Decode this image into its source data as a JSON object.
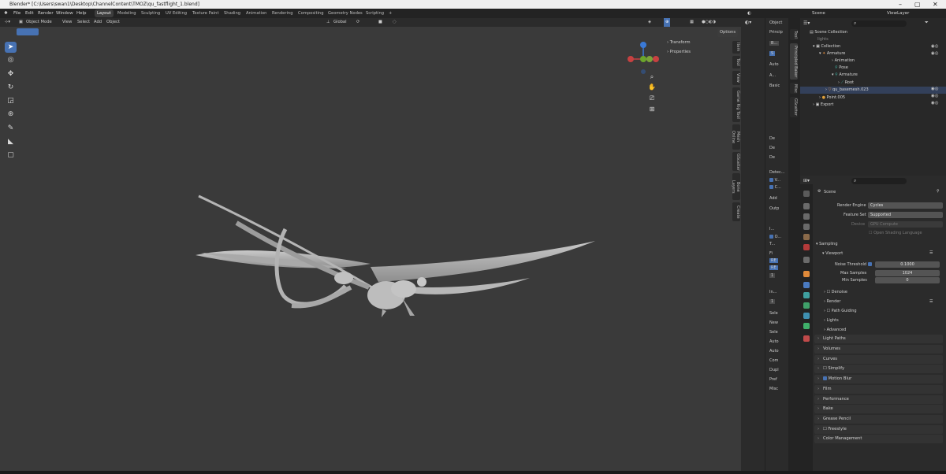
{
  "window": {
    "title": "Blender* [C:\\Users\\swan1\\Desktop\\ChannelContent\\TMOZ\\qu_fastflight_1.blend]"
  },
  "menu": [
    "File",
    "Edit",
    "Render",
    "Window",
    "Help"
  ],
  "workspaces": [
    "Layout",
    "Modeling",
    "Sculpting",
    "UV Editing",
    "Texture Paint",
    "Shading",
    "Animation",
    "Rendering",
    "Compositing",
    "Geometry Nodes",
    "Scripting",
    "+"
  ],
  "viewport": {
    "header": {
      "mode": "Object Mode",
      "menus": [
        "View",
        "Select",
        "Add",
        "Object"
      ],
      "orientation": "Global",
      "options": "Options"
    },
    "npanel": [
      "Transform",
      "Properties"
    ],
    "side_tabs": [
      "Item",
      "Tool",
      "View",
      "Game Rig Tool",
      "Mesh Online",
      "GScatter",
      "Bone Layers",
      "Create"
    ],
    "tools": [
      "select-box",
      "cursor",
      "move",
      "rotate",
      "scale",
      "transform",
      "annotate",
      "measure",
      "add-cube"
    ]
  },
  "mid_tabs": [
    "Tool",
    "Principled Baker",
    "Misc",
    "GScatter"
  ],
  "addon": {
    "mode": "Object",
    "labels": [
      "Princip",
      "B...",
      "S",
      "Auto",
      "A...",
      "Basic",
      "De",
      "De",
      "De",
      "Detec...",
      "V...",
      "C...",
      "Add",
      "Outp",
      "I...",
      "O...",
      "T...",
      "Fi",
      "RE",
      "RE",
      "1",
      "In...",
      "1",
      "Sele",
      "New",
      "Sele",
      "Auto",
      "Auto",
      "Com",
      "Dupl",
      "Pref",
      "Misc"
    ]
  },
  "outliner": {
    "header": {
      "scene": "Scene",
      "viewlayer": "ViewLayer"
    },
    "rows": [
      {
        "label": "Scene Collection",
        "indent": 0
      },
      {
        "label": "lights",
        "indent": 1
      },
      {
        "label": "Collection",
        "indent": 1
      },
      {
        "label": "Armature",
        "indent": 2
      },
      {
        "label": "Animation",
        "indent": 3
      },
      {
        "label": "Pose",
        "indent": 3
      },
      {
        "label": "Armature",
        "indent": 3
      },
      {
        "label": "Root",
        "indent": 4
      },
      {
        "label": "qu_basemesh.023",
        "indent": 3
      },
      {
        "label": "Point.005",
        "indent": 2
      },
      {
        "label": "Export",
        "indent": 1
      }
    ]
  },
  "properties": {
    "context": "Scene",
    "render_engine": {
      "label": "Render Engine",
      "value": "Cycles"
    },
    "feature_set": {
      "label": "Feature Set",
      "value": "Supported"
    },
    "device": {
      "label": "Device",
      "value": "GPU Compute"
    },
    "osl": "Open Shading Language",
    "sampling": "Sampling",
    "viewport": "Viewport",
    "noise_threshold": {
      "label": "Noise Threshold",
      "value": "0.1000"
    },
    "max_samples": {
      "label": "Max Samples",
      "value": "1024"
    },
    "min_samples": {
      "label": "Min Samples",
      "value": "0"
    },
    "subsections": [
      "Denoise",
      "Render",
      "Path Guiding",
      "Lights",
      "Advanced"
    ],
    "sections": [
      "Light Paths",
      "Volumes",
      "Curves",
      "Simplify",
      "Motion Blur",
      "Film",
      "Performance",
      "Bake",
      "Grease Pencil",
      "Freestyle",
      "Color Management"
    ]
  }
}
